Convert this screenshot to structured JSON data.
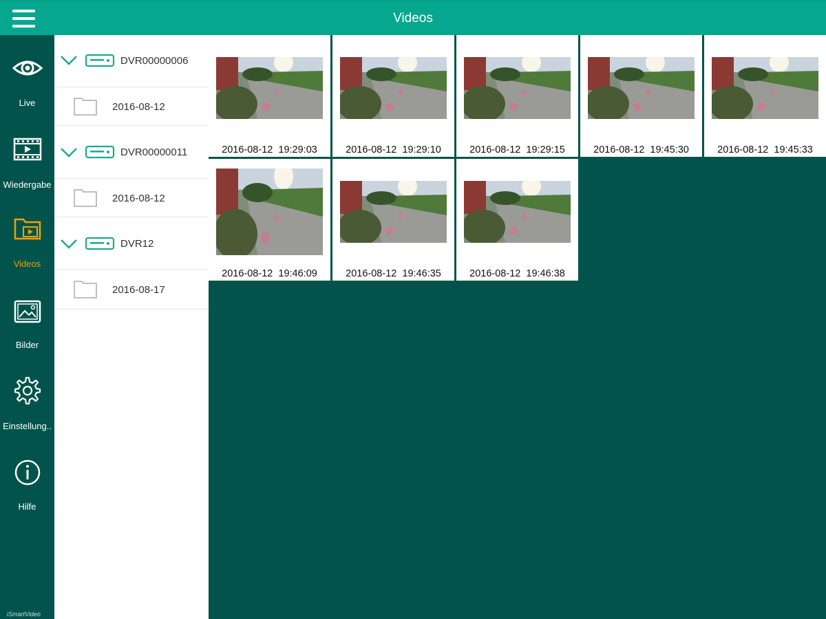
{
  "header": {
    "title": "Videos",
    "menu_icon": "hamburger-menu-icon"
  },
  "nav": {
    "items": [
      {
        "label": "Live",
        "icon": "eye-icon"
      },
      {
        "label": "Wiedergabe",
        "icon": "film-icon"
      },
      {
        "label": "Videos",
        "icon": "video-folder-icon",
        "active": true
      },
      {
        "label": "Bilder",
        "icon": "image-icon"
      },
      {
        "label": "Einstellung..",
        "icon": "gear-icon"
      },
      {
        "label": "Hilfe",
        "icon": "info-icon"
      }
    ],
    "watermark": "iSmartVideo"
  },
  "tree": [
    {
      "dvr": "DVR00000006",
      "folder": "2016-08-12"
    },
    {
      "dvr": "DVR00000011",
      "folder": "2016-08-12"
    },
    {
      "dvr": "DVR12",
      "folder": "2016-08-17"
    }
  ],
  "videos": [
    {
      "date": "2016-08-12",
      "time": "19:29:03"
    },
    {
      "date": "2016-08-12",
      "time": "19:29:10"
    },
    {
      "date": "2016-08-12",
      "time": "19:29:15"
    },
    {
      "date": "2016-08-12",
      "time": "19:45:30"
    },
    {
      "date": "2016-08-12",
      "time": "19:45:33"
    },
    {
      "date": "2016-08-12",
      "time": "19:46:09"
    },
    {
      "date": "2016-08-12",
      "time": "19:46:35"
    },
    {
      "date": "2016-08-12",
      "time": "19:46:38"
    }
  ],
  "colors": {
    "header": "#05a88e",
    "sidebar": "#02534b",
    "active": "#f5a000",
    "accent": "#1aa98f"
  }
}
